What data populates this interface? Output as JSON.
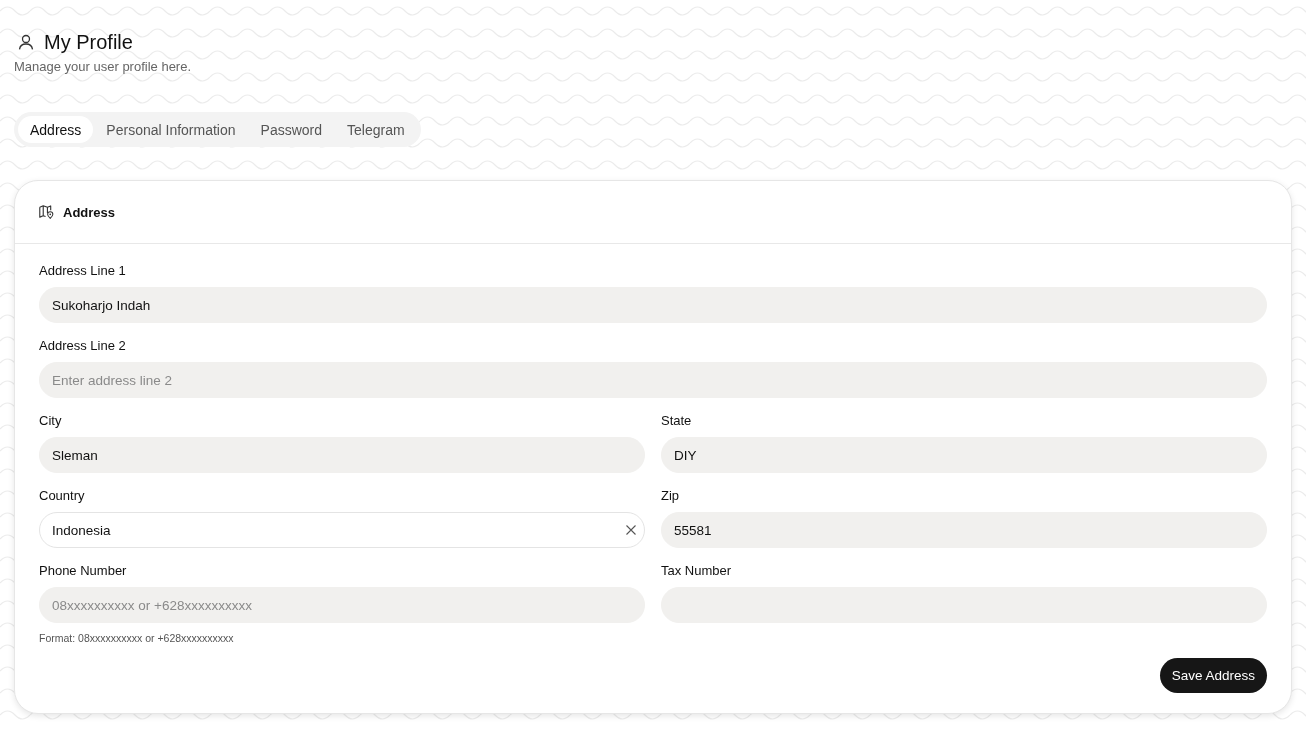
{
  "header": {
    "title": "My Profile",
    "subtitle": "Manage your user profile here."
  },
  "tabs": [
    {
      "label": "Address",
      "selected": true
    },
    {
      "label": "Personal Information",
      "selected": false
    },
    {
      "label": "Password",
      "selected": false
    },
    {
      "label": "Telegram",
      "selected": false
    }
  ],
  "card": {
    "title": "Address",
    "rows": [
      [
        {
          "label": "Address Line 1",
          "kind": "text",
          "value": "Sukoharjo Indah"
        }
      ],
      [
        {
          "label": "Address Line 2",
          "kind": "text",
          "placeholder": "Enter address line 2"
        }
      ],
      [
        {
          "label": "City",
          "kind": "text",
          "value": "Sleman"
        },
        {
          "label": "State",
          "kind": "text",
          "value": "DIY"
        }
      ],
      [
        {
          "label": "Country",
          "kind": "combobox",
          "value": "Indonesia"
        },
        {
          "label": "Zip",
          "kind": "text",
          "value": "55581"
        }
      ],
      [
        {
          "label": "Phone Number",
          "kind": "text",
          "placeholder": "08xxxxxxxxxx or +628xxxxxxxxxx",
          "hint": "Format: 08xxxxxxxxxx or +628xxxxxxxxxx"
        },
        {
          "label": "Tax Number",
          "kind": "text"
        }
      ]
    ],
    "button": "Save Address"
  }
}
